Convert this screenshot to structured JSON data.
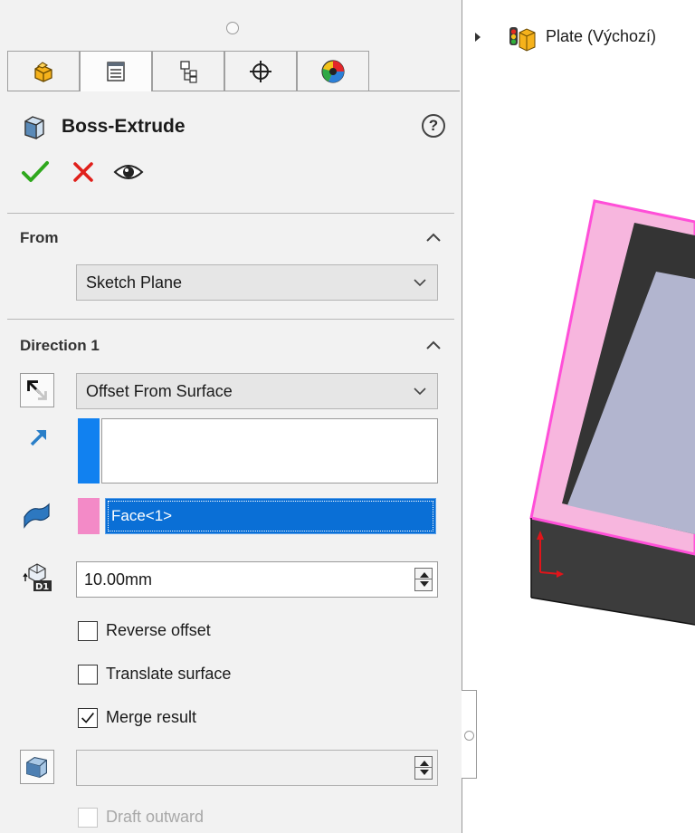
{
  "feature": {
    "title": "Boss-Extrude",
    "help": "?"
  },
  "tabs": [
    {
      "name": "feature-manager",
      "icon": "feature-manager-icon"
    },
    {
      "name": "property-manager",
      "icon": "property-manager-icon",
      "active": true
    },
    {
      "name": "configuration-manager",
      "icon": "configuration-manager-icon"
    },
    {
      "name": "dimxpert-manager",
      "icon": "crosshair-icon"
    },
    {
      "name": "display-manager",
      "icon": "display-manager-icon"
    }
  ],
  "actions": {
    "ok": "checkmark-icon",
    "cancel": "close-icon",
    "preview": "eye-icon"
  },
  "from": {
    "heading": "From",
    "value": "Sketch Plane"
  },
  "direction1": {
    "heading": "Direction 1",
    "end_condition": "Offset From Surface",
    "direction_value": "",
    "face_value": "Face<1>",
    "offset_value": "10.00mm",
    "reverse_offset_label": "Reverse offset",
    "reverse_offset_checked": false,
    "translate_surface_label": "Translate surface",
    "translate_surface_checked": false,
    "merge_result_label": "Merge result",
    "merge_result_checked": true,
    "draft_value": "",
    "draft_outward_label": "Draft outward",
    "draft_outward_checked": false
  },
  "tree": {
    "item_label": "Plate  (Výchozí)"
  },
  "colors": {
    "accent_blue": "#0a6fd6",
    "direction_swatch": "#1181f0",
    "face_swatch": "#f38ac7",
    "ok_green": "#2fa81d",
    "cancel_red": "#e0201b",
    "edge_highlight": "#ff4fd8"
  }
}
